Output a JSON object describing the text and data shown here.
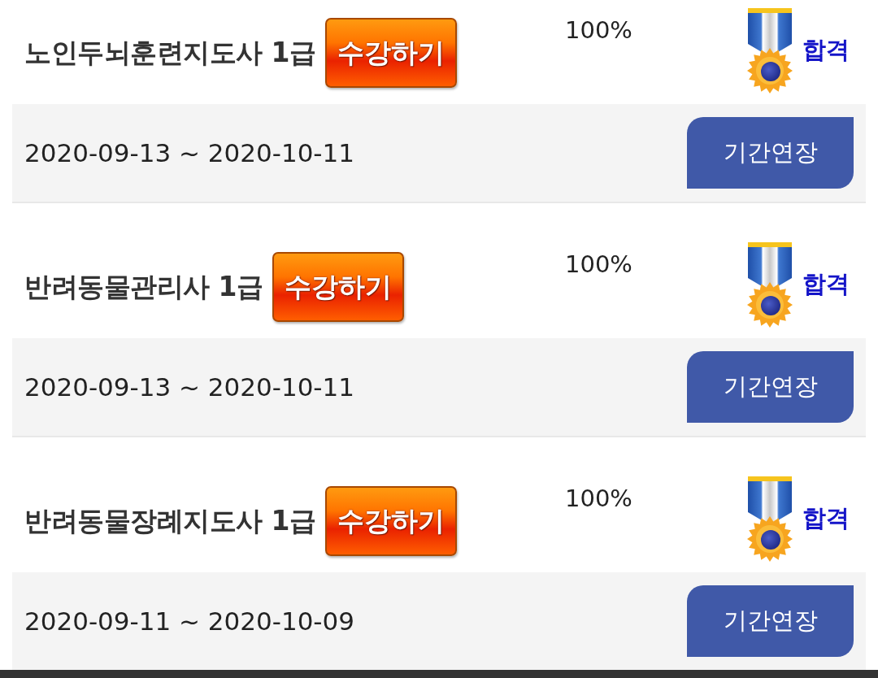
{
  "courses": [
    {
      "title": "노인두뇌훈련지도사 1급",
      "enroll_button": "수강하기",
      "progress": "100%",
      "result": "합격",
      "period": "2020-09-13 ~ 2020-10-11",
      "extend_button": "기간연장"
    },
    {
      "title": "반려동물관리사 1급",
      "enroll_button": "수강하기",
      "progress": "100%",
      "result": "합격",
      "period": "2020-09-13 ~ 2020-10-11",
      "extend_button": "기간연장"
    },
    {
      "title": "반려동물장례지도사 1급",
      "enroll_button": "수강하기",
      "progress": "100%",
      "result": "합격",
      "period": "2020-09-11 ~ 2020-10-09",
      "extend_button": "기간연장"
    }
  ]
}
